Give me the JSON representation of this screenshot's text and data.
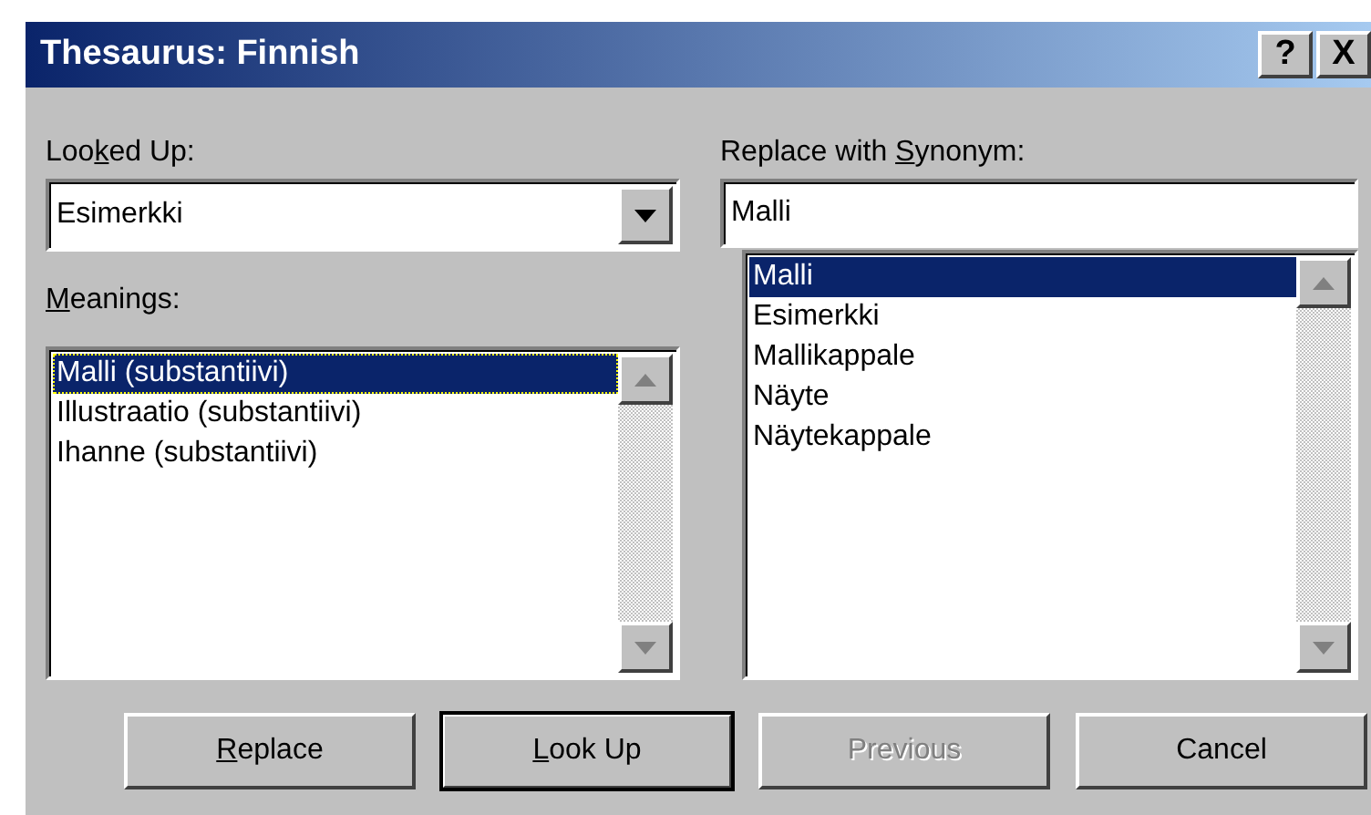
{
  "window": {
    "title": "Thesaurus: Finnish",
    "buttons": [
      "?",
      "X"
    ]
  },
  "looked_up": {
    "label": {
      "before": "Loo",
      "key": "k",
      "after": "ed Up:"
    },
    "value": "Esimerkki"
  },
  "meanings": {
    "label": {
      "key": "M",
      "after": "eanings:"
    },
    "items": [
      {
        "text": "Malli (substantiivi)",
        "selected": true
      },
      {
        "text": "Illustraatio (substantiivi)",
        "selected": false
      },
      {
        "text": "Ihanne (substantiivi)",
        "selected": false
      }
    ]
  },
  "synonym": {
    "label": {
      "before": "Replace with ",
      "key": "S",
      "after": "ynonym:"
    },
    "value": "Malli",
    "items": [
      {
        "text": "Malli",
        "selected": true
      },
      {
        "text": "Esimerkki",
        "selected": false
      },
      {
        "text": "Mallikappale",
        "selected": false
      },
      {
        "text": "Näyte",
        "selected": false
      },
      {
        "text": "Näytekappale",
        "selected": false
      }
    ]
  },
  "buttons": [
    {
      "label": {
        "key": "R",
        "after": "eplace"
      },
      "default": false,
      "disabled": false
    },
    {
      "label": {
        "key": "L",
        "after": "ook Up"
      },
      "default": true,
      "disabled": false
    },
    {
      "label": {
        "before": "Previous"
      },
      "default": false,
      "disabled": true
    },
    {
      "label": {
        "before": "Cancel"
      },
      "default": false,
      "disabled": false
    }
  ]
}
